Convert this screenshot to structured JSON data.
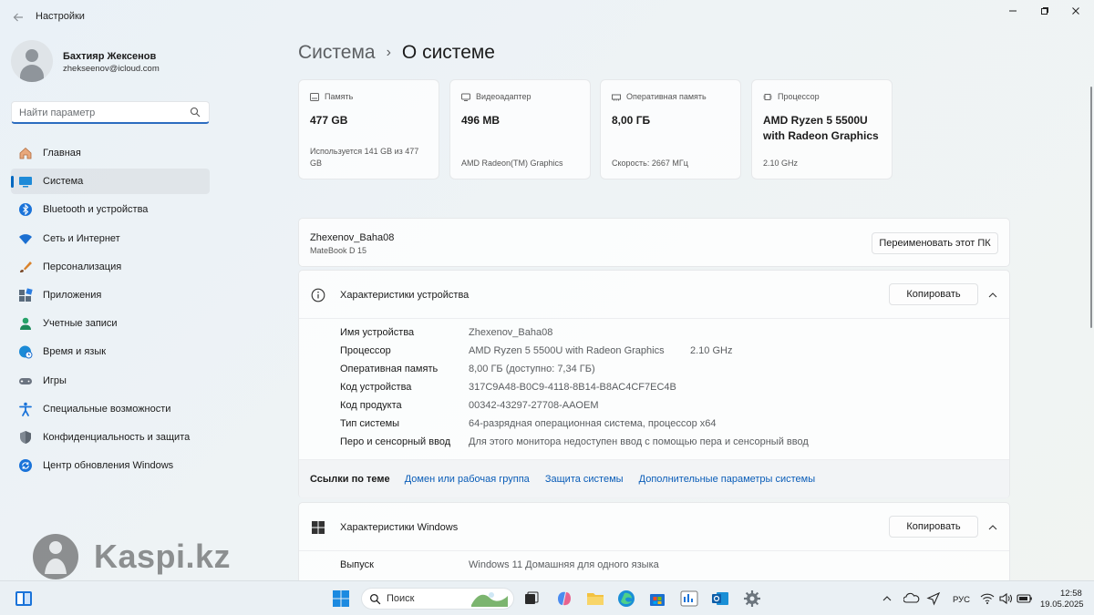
{
  "window": {
    "title": "Настройки",
    "back_icon": "arrow-left-icon",
    "controls": [
      "minimize-icon",
      "restore-icon",
      "close-icon"
    ]
  },
  "profile": {
    "name": "Бахтияр Жексенов",
    "email": "zhekseenov@icloud.com"
  },
  "search": {
    "placeholder": "Найти параметр"
  },
  "sidebar": {
    "items": [
      {
        "label": "Главная",
        "icon": "home-icon"
      },
      {
        "label": "Система",
        "icon": "monitor-icon",
        "active": true
      },
      {
        "label": "Bluetooth и устройства",
        "icon": "bluetooth-icon"
      },
      {
        "label": "Сеть и Интернет",
        "icon": "wifi-icon"
      },
      {
        "label": "Персонализация",
        "icon": "brush-icon"
      },
      {
        "label": "Приложения",
        "icon": "apps-icon"
      },
      {
        "label": "Учетные записи",
        "icon": "person-icon"
      },
      {
        "label": "Время и язык",
        "icon": "globe-clock-icon"
      },
      {
        "label": "Игры",
        "icon": "gamepad-icon"
      },
      {
        "label": "Специальные возможности",
        "icon": "accessibility-icon"
      },
      {
        "label": "Конфиденциальность и защита",
        "icon": "shield-icon"
      },
      {
        "label": "Центр обновления Windows",
        "icon": "update-icon"
      }
    ]
  },
  "watermark": {
    "text": "Kaspi.kz"
  },
  "header": {
    "parent": "Система",
    "separator": "›",
    "current": "О системе"
  },
  "cards": [
    {
      "title": "Память",
      "value": "477 GB",
      "sub": "Используется 141 GB из 477 GB",
      "icon": "storage-icon"
    },
    {
      "title": "Видеоадаптер",
      "value": "496 MB",
      "sub": "AMD Radeon(TM) Graphics",
      "icon": "gpu-icon"
    },
    {
      "title": "Оперативная память",
      "value": "8,00 ГБ",
      "sub": "Скорость: 2667 МГц",
      "icon": "ram-icon"
    },
    {
      "title": "Процессор",
      "value": "AMD Ryzen 5 5500U with Radeon Graphics",
      "sub": "2.10 GHz",
      "icon": "cpu-icon"
    }
  ],
  "pc": {
    "name": "Zhexenov_Baha08",
    "model": "MateBook D 15",
    "rename_button": "Переименовать этот ПК"
  },
  "device_specs": {
    "title": "Характеристики устройства",
    "copy_button": "Копировать",
    "rows": [
      {
        "label": "Имя устройства",
        "value": "Zhexenov_Baha08",
        "extra": ""
      },
      {
        "label": "Процессор",
        "value": "AMD Ryzen 5 5500U with Radeon Graphics",
        "extra": "2.10 GHz"
      },
      {
        "label": "Оперативная память",
        "value": "8,00 ГБ (доступно: 7,34 ГБ)",
        "extra": ""
      },
      {
        "label": "Код устройства",
        "value": "317C9A48-B0C9-4118-8B14-B8AC4CF7EC4B",
        "extra": ""
      },
      {
        "label": "Код продукта",
        "value": "00342-43297-27708-AAOEM",
        "extra": ""
      },
      {
        "label": "Тип системы",
        "value": "64-разрядная операционная система, процессор x64",
        "extra": ""
      },
      {
        "label": "Перо и сенсорный ввод",
        "value": "Для этого монитора недоступен ввод с помощью пера и сенсорный ввод",
        "extra": ""
      }
    ]
  },
  "related_links": {
    "label": "Ссылки по теме",
    "links": [
      "Домен или рабочая группа",
      "Защита системы",
      "Дополнительные параметры системы"
    ]
  },
  "windows_specs": {
    "title": "Характеристики Windows",
    "copy_button": "Копировать",
    "rows": [
      {
        "label": "Выпуск",
        "value": "Windows 11 Домашняя для одного языка"
      }
    ]
  },
  "taskbar": {
    "search_label": "Поиск",
    "language": "РУС",
    "time": "12:58",
    "date": "19.05.2025",
    "colors": {
      "accent": "#0067c0",
      "link": "#0a5db8"
    }
  }
}
